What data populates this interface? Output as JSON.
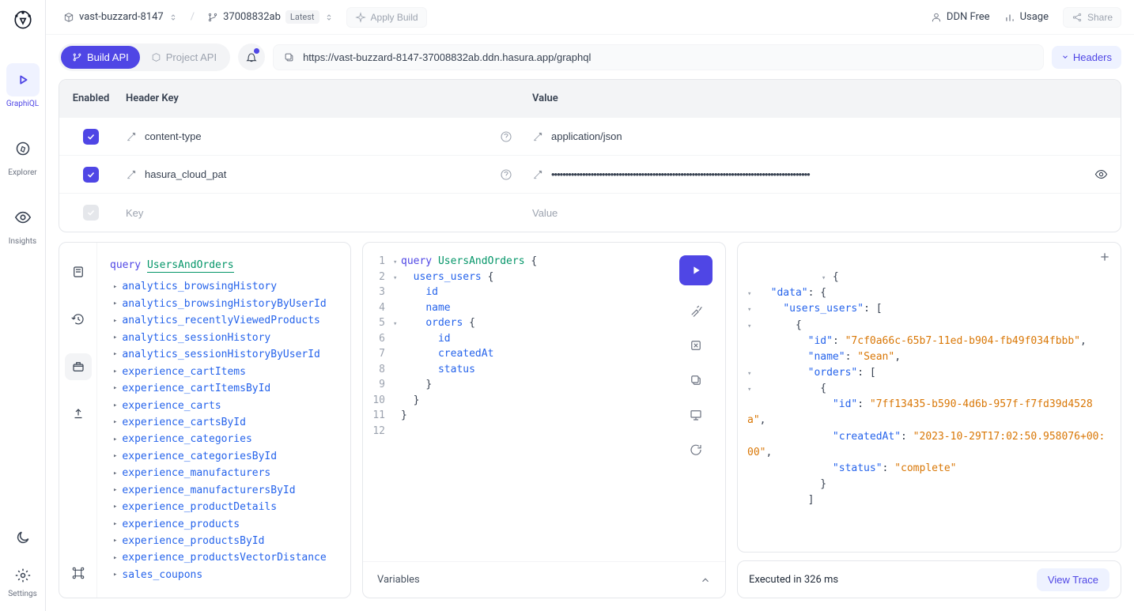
{
  "sidebar": {
    "items": [
      {
        "label": "GraphiQL"
      },
      {
        "label": "Explorer"
      },
      {
        "label": "Insights"
      },
      {
        "label": "Settings"
      }
    ]
  },
  "topbar": {
    "project": "vast-buzzard-8147",
    "build": "37008832ab",
    "badge": "Latest",
    "apply_build": "Apply Build",
    "ddn_free": "DDN Free",
    "usage": "Usage",
    "share": "Share"
  },
  "actionbar": {
    "build_api": "Build API",
    "project_api": "Project API",
    "url": "https://vast-buzzard-8147-37008832ab.ddn.hasura.app/graphql",
    "headers_btn": "Headers"
  },
  "headers_table": {
    "col_enabled": "Enabled",
    "col_key": "Header Key",
    "col_value": "Value",
    "rows": [
      {
        "enabled": true,
        "key": "content-type",
        "value": "application/json",
        "masked": false
      },
      {
        "enabled": true,
        "key": "hasura_cloud_pat",
        "value": "••••••••••••••••••••••••••••••••••••••••••••••••••••••••••••••••••••••••••••••••••••••••••••",
        "masked": true
      }
    ],
    "placeholder_key": "Key",
    "placeholder_value": "Value"
  },
  "explorer": {
    "query_kw": "query",
    "query_name": "UsersAndOrders",
    "fields": [
      "analytics_browsingHistory",
      "analytics_browsingHistoryByUserId",
      "analytics_recentlyViewedProducts",
      "analytics_sessionHistory",
      "analytics_sessionHistoryByUserId",
      "experience_cartItems",
      "experience_cartItemsById",
      "experience_carts",
      "experience_cartsById",
      "experience_categories",
      "experience_categoriesById",
      "experience_manufacturers",
      "experience_manufacturersById",
      "experience_productDetails",
      "experience_products",
      "experience_productsById",
      "experience_productsVectorDistance",
      "sales_coupons"
    ]
  },
  "editor": {
    "line_count": 12,
    "lines": {
      "l1_kw": "query",
      "l1_name": "UsersAndOrders",
      "l1_brace": "{",
      "l2_field": "users_users",
      "l2_brace": "{",
      "l3": "id",
      "l4": "name",
      "l5_field": "orders",
      "l5_brace": "{",
      "l6": "id",
      "l7": "createdAt",
      "l8": "status",
      "l9": "}",
      "l10": "}",
      "l11": "}"
    },
    "variables_label": "Variables"
  },
  "response": {
    "data_key": "\"data\"",
    "users_key": "\"users_users\"",
    "id_key": "\"id\"",
    "id_val": "\"7cf0a66c-65b7-11ed-b904-fb49f034fbbb\"",
    "name_key": "\"name\"",
    "name_val": "\"Sean\"",
    "orders_key": "\"orders\"",
    "order_id_key": "\"id\"",
    "order_id_val": "\"7ff13435-b590-4d6b-957f-f7fd39d4528a\"",
    "created_key": "\"createdAt\"",
    "created_val": "\"2023-10-29T17:02:50.958076+00:00\"",
    "status_key": "\"status\"",
    "status_val": "\"complete\"",
    "footer_status": "Executed in 326 ms",
    "view_trace": "View Trace"
  }
}
